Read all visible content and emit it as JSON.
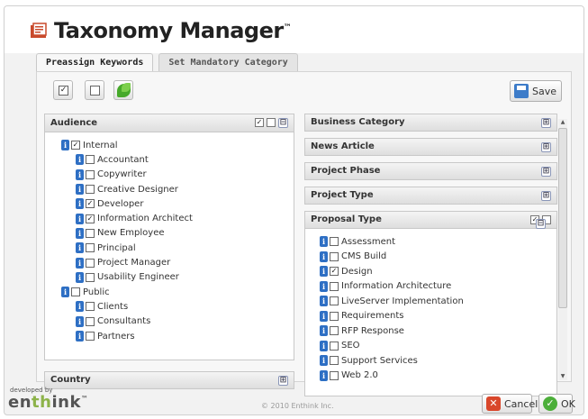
{
  "app": {
    "title": "Taxonomy Manager",
    "trademark": "™"
  },
  "tabs": [
    {
      "label": "Preassign Keywords",
      "active": true
    },
    {
      "label": "Set Mandatory Category",
      "active": false
    }
  ],
  "toolbar": {
    "check_all_glyph": "✓",
    "save_label": "Save"
  },
  "audience": {
    "title": "Audience",
    "head_check": "✓",
    "collapse": "⊟",
    "items": [
      {
        "label": "Internal",
        "checked": "✓",
        "level": 1
      },
      {
        "label": "Accountant",
        "checked": "",
        "level": 2
      },
      {
        "label": "Copywriter",
        "checked": "",
        "level": 2
      },
      {
        "label": "Creative Designer",
        "checked": "",
        "level": 2
      },
      {
        "label": "Developer",
        "checked": "✓",
        "level": 2
      },
      {
        "label": "Information Architect",
        "checked": "✓",
        "level": 2
      },
      {
        "label": "New Employee",
        "checked": "",
        "level": 2
      },
      {
        "label": "Principal",
        "checked": "",
        "level": 2
      },
      {
        "label": "Project Manager",
        "checked": "",
        "level": 2
      },
      {
        "label": "Usability Engineer",
        "checked": "",
        "level": 2
      },
      {
        "label": "Public",
        "checked": "",
        "level": 1
      },
      {
        "label": "Clients",
        "checked": "",
        "level": 2
      },
      {
        "label": "Consultants",
        "checked": "",
        "level": 2
      },
      {
        "label": "Partners",
        "checked": "",
        "level": 2
      }
    ]
  },
  "country": {
    "title": "Country",
    "expand": "⊞"
  },
  "right_panels": [
    {
      "title": "Business Category",
      "expand": "⊞"
    },
    {
      "title": "News Article",
      "expand": "⊞"
    },
    {
      "title": "Project Phase",
      "expand": "⊞"
    },
    {
      "title": "Project Type",
      "expand": "⊞"
    }
  ],
  "proposal": {
    "title": "Proposal Type",
    "head_check": "✓",
    "collapse": "⊟",
    "items": [
      {
        "label": "Assessment",
        "checked": ""
      },
      {
        "label": "CMS Build",
        "checked": ""
      },
      {
        "label": "Design",
        "checked": "✓"
      },
      {
        "label": "Information Architecture",
        "checked": ""
      },
      {
        "label": "LiveServer Implementation",
        "checked": ""
      },
      {
        "label": "Requirements",
        "checked": ""
      },
      {
        "label": "RFP Response",
        "checked": ""
      },
      {
        "label": "SEO",
        "checked": ""
      },
      {
        "label": "Support Services",
        "checked": ""
      },
      {
        "label": "Web 2.0",
        "checked": ""
      }
    ]
  },
  "info_glyph": "i",
  "footer": {
    "developed_by": "developed by",
    "brand_prefix": "en",
    "brand_highlight": "th",
    "brand_suffix": "ink",
    "brand_tm": "™",
    "copyright": "© 2010 Enthink Inc.",
    "cancel_label": "Cancel",
    "cancel_glyph": "✕",
    "ok_label": "OK",
    "ok_glyph": "✓"
  },
  "colors": {
    "accent_blue": "#2e6fc4",
    "brand_green": "#8db34a",
    "cancel_red": "#d9472b",
    "ok_green": "#4caf3a"
  },
  "icons": [
    "document-icon",
    "check-all-icon",
    "uncheck-all-icon",
    "leaf-icon",
    "save-icon",
    "info-icon",
    "collapse-icon",
    "expand-icon",
    "cancel-icon",
    "ok-icon"
  ]
}
